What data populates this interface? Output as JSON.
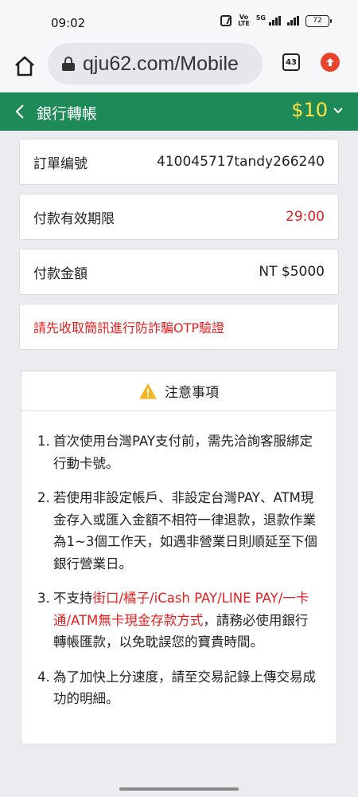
{
  "status": {
    "time": "09:02",
    "network_label": "5G",
    "volte": "VoLTE",
    "battery": "72"
  },
  "browser": {
    "url": "qju62.com/Mobile",
    "tab_count": "43"
  },
  "header": {
    "title": "銀行轉帳",
    "balance": "$10"
  },
  "info": [
    {
      "label": "訂單编號",
      "value": "410045717tandy266240"
    },
    {
      "label": "付款有效期限",
      "value": "29:00"
    },
    {
      "label": "付款金額",
      "value": "NT $5000"
    }
  ],
  "warning": "請先收取簡訊進行防詐騙OTP驗證",
  "notice": {
    "title": "注意事項",
    "items": [
      {
        "num": "1.",
        "text": "首次使用台灣PAY支付前，需先洽詢客服綁定行動卡號。"
      },
      {
        "num": "2.",
        "text": "若使用非設定帳戶、非設定台灣PAY、ATM現金存入或匯入金額不相符一律退款，退款作業為1~3個工作天，如遇非營業日則順延至下個銀行營業日。"
      },
      {
        "num": "3.",
        "text_before": "不支持",
        "text_red": "街口/橘子/iCash PAY/LINE PAY/一卡通/ATM無卡現金存款方式",
        "text_after": "，請務必使用銀行轉帳匯款，以免耽誤您的寶貴時間。"
      },
      {
        "num": "4.",
        "text": "為了加快上分速度，請至交易記錄上傳交易成功的明細。"
      }
    ]
  },
  "colors": {
    "header_green": "#1e8a57",
    "balance_yellow": "#ffe342",
    "alert_red": "#e52020"
  }
}
